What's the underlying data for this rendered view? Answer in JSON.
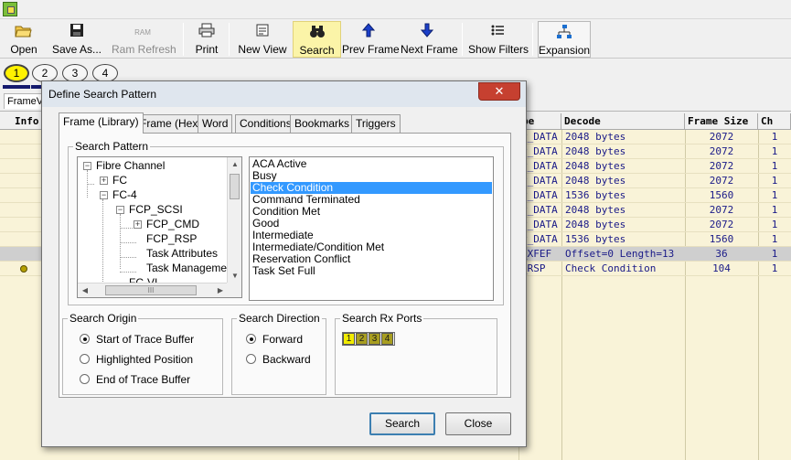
{
  "toolbar": {
    "open": "Open",
    "save_as": "Save As...",
    "ram_refresh": "Ram Refresh",
    "ram_icon_text": "RAM",
    "print": "Print",
    "new_view": "New View",
    "search": "Search",
    "prev_frame": "Prev Frame",
    "next_frame": "Next Frame",
    "show_filters": "Show Filters",
    "expansion": "Expansion"
  },
  "bookmarks": [
    "1",
    "2",
    "3",
    "4"
  ],
  "view_tab": "FrameVi",
  "grid": {
    "headers": {
      "info": "Info",
      "type": "pe",
      "decode": "Decode",
      "frame_size": "Frame Size",
      "ch": "Ch"
    },
    "rows": [
      {
        "type": "P_DATA",
        "decode": "2048 bytes",
        "size": "2072",
        "ch": "1"
      },
      {
        "type": "P_DATA",
        "decode": "2048 bytes",
        "size": "2072",
        "ch": "1"
      },
      {
        "type": "P_DATA",
        "decode": "2048 bytes",
        "size": "2072",
        "ch": "1"
      },
      {
        "type": "P_DATA",
        "decode": "2048 bytes",
        "size": "2072",
        "ch": "1"
      },
      {
        "type": "P_DATA",
        "decode": "1536 bytes",
        "size": "1560",
        "ch": "1"
      },
      {
        "type": "P_DATA",
        "decode": "2048 bytes",
        "size": "2072",
        "ch": "1"
      },
      {
        "type": "P_DATA",
        "decode": "2048 bytes",
        "size": "2072",
        "ch": "1"
      },
      {
        "type": "P_DATA",
        "decode": "1536 bytes",
        "size": "1560",
        "ch": "1"
      },
      {
        "type": "_XFEF",
        "decode": "Offset=0 Length=13",
        "size": "36",
        "ch": "1"
      },
      {
        "type": "_RSP",
        "decode": "Check Condition",
        "size": "104",
        "ch": "1"
      }
    ]
  },
  "dialog": {
    "title": "Define Search Pattern",
    "close_glyph": "✕",
    "tabs": [
      "Frame (Library)",
      "Frame (Hex)",
      "Word",
      "Conditions",
      "Bookmarks",
      "Triggers"
    ],
    "search_pattern_label": "Search Pattern",
    "tree": [
      "Fibre Channel",
      "FC",
      "FC-4",
      "FCP_SCSI",
      "FCP_CMD",
      "FCP_RSP",
      "Task Attributes",
      "Task Management",
      "FC-VI"
    ],
    "list": [
      "ACA Active",
      "Busy",
      "Check Condition",
      "Command Terminated",
      "Condition Met",
      "Good",
      "Intermediate",
      "Intermediate/Condition Met",
      "Reservation Conflict",
      "Task Set Full"
    ],
    "list_selected": "Check Condition",
    "scroll_grip": "III",
    "search_origin": {
      "label": "Search Origin",
      "options": [
        "Start of Trace Buffer",
        "Highlighted Position",
        "End of Trace Buffer"
      ],
      "selected": "Start of Trace Buffer"
    },
    "search_direction": {
      "label": "Search Direction",
      "options": [
        "Forward",
        "Backward"
      ],
      "selected": "Forward"
    },
    "rx_ports": {
      "label": "Search Rx Ports",
      "ports": [
        "1",
        "2",
        "3",
        "4"
      ]
    },
    "search_button": "Search",
    "close_button": "Close"
  },
  "colors": {
    "accent_yellow": "#fff200",
    "selection_blue": "#3399ff",
    "grid_bg": "#f9f3d8",
    "bookmark_bar": "#151a6e"
  }
}
